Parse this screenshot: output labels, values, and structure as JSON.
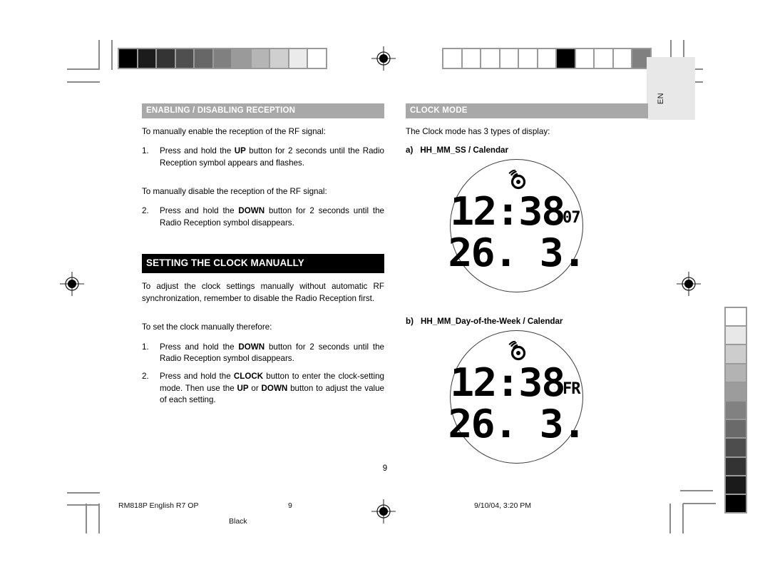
{
  "document": {
    "page_number": "9",
    "language_tab": "EN"
  },
  "left_column": {
    "section1": {
      "heading": "ENABLING / DISABLING RECEPTION",
      "intro_enable": "To manually enable the reception of the RF signal:",
      "step1_num": "1.",
      "step1_text_a": "Press and hold the ",
      "step1_bold": "UP",
      "step1_text_b": " button for 2 seconds until the Radio Reception symbol appears and flashes.",
      "intro_disable": "To manually disable the reception of the RF signal:",
      "step2_num": "2.",
      "step2_text_a": "Press and hold the ",
      "step2_bold": "DOWN",
      "step2_text_b": " button for 2 seconds until the Radio Reception symbol disappears."
    },
    "section2": {
      "heading": "SETTING THE CLOCK MANUALLY",
      "intro": "To adjust the clock settings manually without automatic RF synchronization, remember to disable the Radio Reception first.",
      "intro2": "To set the clock manually therefore:",
      "step1_num": "1.",
      "step1_text_a": "Press and hold the ",
      "step1_bold": "DOWN",
      "step1_text_b": " button for 2 seconds until the Radio Reception symbol disappears.",
      "step2_num": "2.",
      "step2_text_a": "Press and hold the ",
      "step2_bold1": "CLOCK",
      "step2_text_b": " button to enter the clock-setting mode. Then use the ",
      "step2_bold2": "UP",
      "step2_text_c": " or ",
      "step2_bold3": "DOWN",
      "step2_text_d": " button to adjust the value of each setting."
    }
  },
  "right_column": {
    "heading": "CLOCK MODE",
    "intro": "The Clock mode has 3 types of display:",
    "display_a": {
      "marker": "a)",
      "label": "HH_MM_SS / Calendar",
      "lcd": {
        "time": "12:38",
        "suffix": "07",
        "date": "26. 3.",
        "icon": "radio-reception-icon"
      }
    },
    "display_b": {
      "marker": "b)",
      "label": "HH_MM_Day-of-the-Week / Calendar",
      "lcd": {
        "time": "12:38",
        "suffix": "FR",
        "date": "26. 3.",
        "icon": "radio-reception-icon"
      }
    }
  },
  "footer": {
    "doc_id": "RM818P English R7 OP",
    "page": "9",
    "plate": "Black",
    "timestamp": "9/10/04, 3:20 PM"
  },
  "prepress": {
    "top_left_wedge": {
      "name": "grayscale-step-wedge",
      "patches": [
        "#000000",
        "#1c1c1c",
        "#343434",
        "#4f4f4f",
        "#676767",
        "#808080",
        "#9a9a9a",
        "#b5b5b5",
        "#cfcfcf",
        "#ebebeb",
        "#ffffff"
      ]
    },
    "top_right_wedge": {
      "name": "registration-patch-bar",
      "patches": [
        "#ffffff",
        "#ffffff",
        "#ffffff",
        "#ffffff",
        "#ffffff",
        "#ffffff",
        "#000000",
        "#ffffff",
        "#ffffff",
        "#ffffff",
        "#808080"
      ]
    },
    "right_edge_wedge": {
      "name": "vertical-grayscale-wedge",
      "patches": [
        "#ffffff",
        "#e8e8e8",
        "#cdcdcd",
        "#b3b3b3",
        "#9c9c9c",
        "#818181",
        "#6a6a6a",
        "#4d4d4d",
        "#333333",
        "#1a1a1a",
        "#000000"
      ]
    }
  }
}
